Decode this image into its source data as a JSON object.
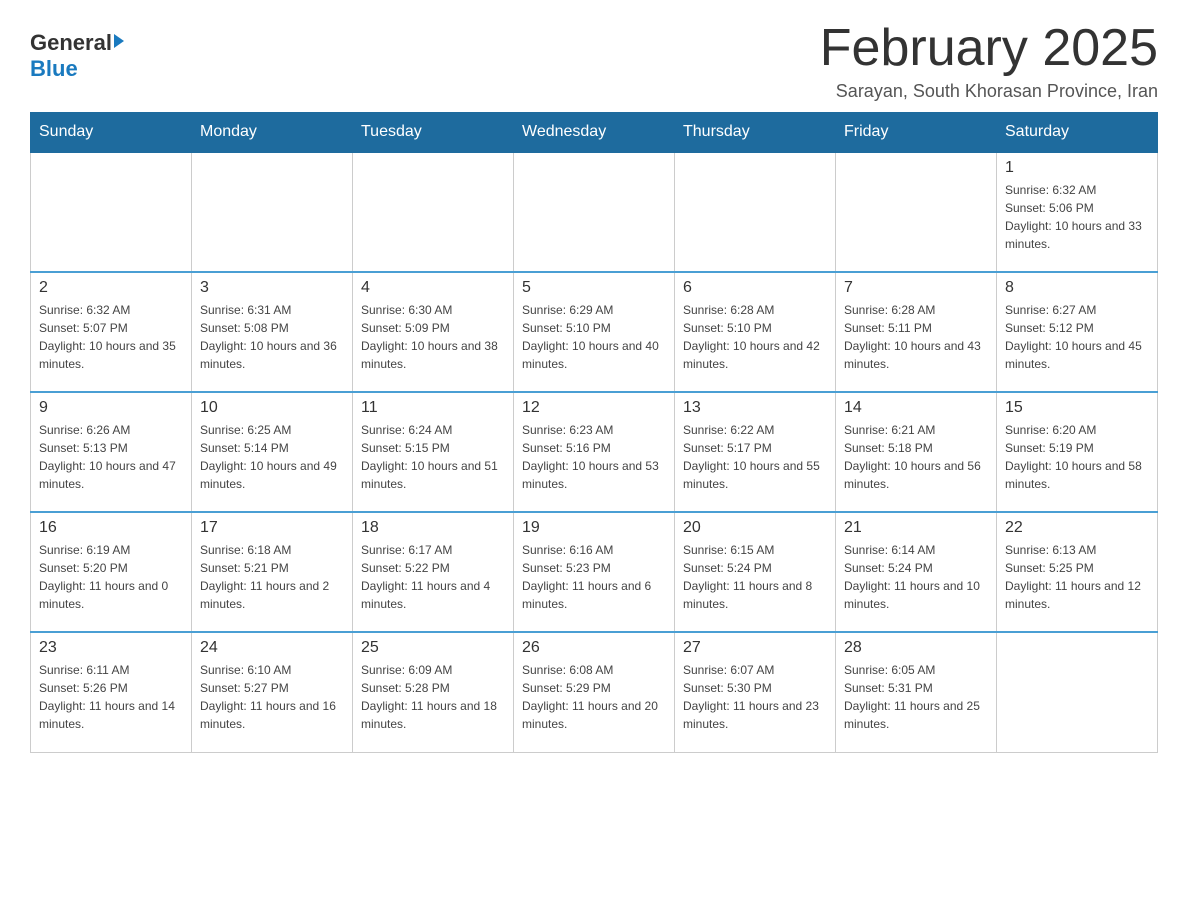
{
  "logo": {
    "general": "General",
    "blue": "Blue"
  },
  "title": {
    "month": "February 2025",
    "location": "Sarayan, South Khorasan Province, Iran"
  },
  "weekdays": [
    "Sunday",
    "Monday",
    "Tuesday",
    "Wednesday",
    "Thursday",
    "Friday",
    "Saturday"
  ],
  "weeks": [
    [
      {
        "day": null
      },
      {
        "day": null
      },
      {
        "day": null
      },
      {
        "day": null
      },
      {
        "day": null
      },
      {
        "day": null
      },
      {
        "day": "1",
        "sunrise": "6:32 AM",
        "sunset": "5:06 PM",
        "daylight": "10 hours and 33 minutes."
      }
    ],
    [
      {
        "day": "2",
        "sunrise": "6:32 AM",
        "sunset": "5:07 PM",
        "daylight": "10 hours and 35 minutes."
      },
      {
        "day": "3",
        "sunrise": "6:31 AM",
        "sunset": "5:08 PM",
        "daylight": "10 hours and 36 minutes."
      },
      {
        "day": "4",
        "sunrise": "6:30 AM",
        "sunset": "5:09 PM",
        "daylight": "10 hours and 38 minutes."
      },
      {
        "day": "5",
        "sunrise": "6:29 AM",
        "sunset": "5:10 PM",
        "daylight": "10 hours and 40 minutes."
      },
      {
        "day": "6",
        "sunrise": "6:28 AM",
        "sunset": "5:10 PM",
        "daylight": "10 hours and 42 minutes."
      },
      {
        "day": "7",
        "sunrise": "6:28 AM",
        "sunset": "5:11 PM",
        "daylight": "10 hours and 43 minutes."
      },
      {
        "day": "8",
        "sunrise": "6:27 AM",
        "sunset": "5:12 PM",
        "daylight": "10 hours and 45 minutes."
      }
    ],
    [
      {
        "day": "9",
        "sunrise": "6:26 AM",
        "sunset": "5:13 PM",
        "daylight": "10 hours and 47 minutes."
      },
      {
        "day": "10",
        "sunrise": "6:25 AM",
        "sunset": "5:14 PM",
        "daylight": "10 hours and 49 minutes."
      },
      {
        "day": "11",
        "sunrise": "6:24 AM",
        "sunset": "5:15 PM",
        "daylight": "10 hours and 51 minutes."
      },
      {
        "day": "12",
        "sunrise": "6:23 AM",
        "sunset": "5:16 PM",
        "daylight": "10 hours and 53 minutes."
      },
      {
        "day": "13",
        "sunrise": "6:22 AM",
        "sunset": "5:17 PM",
        "daylight": "10 hours and 55 minutes."
      },
      {
        "day": "14",
        "sunrise": "6:21 AM",
        "sunset": "5:18 PM",
        "daylight": "10 hours and 56 minutes."
      },
      {
        "day": "15",
        "sunrise": "6:20 AM",
        "sunset": "5:19 PM",
        "daylight": "10 hours and 58 minutes."
      }
    ],
    [
      {
        "day": "16",
        "sunrise": "6:19 AM",
        "sunset": "5:20 PM",
        "daylight": "11 hours and 0 minutes."
      },
      {
        "day": "17",
        "sunrise": "6:18 AM",
        "sunset": "5:21 PM",
        "daylight": "11 hours and 2 minutes."
      },
      {
        "day": "18",
        "sunrise": "6:17 AM",
        "sunset": "5:22 PM",
        "daylight": "11 hours and 4 minutes."
      },
      {
        "day": "19",
        "sunrise": "6:16 AM",
        "sunset": "5:23 PM",
        "daylight": "11 hours and 6 minutes."
      },
      {
        "day": "20",
        "sunrise": "6:15 AM",
        "sunset": "5:24 PM",
        "daylight": "11 hours and 8 minutes."
      },
      {
        "day": "21",
        "sunrise": "6:14 AM",
        "sunset": "5:24 PM",
        "daylight": "11 hours and 10 minutes."
      },
      {
        "day": "22",
        "sunrise": "6:13 AM",
        "sunset": "5:25 PM",
        "daylight": "11 hours and 12 minutes."
      }
    ],
    [
      {
        "day": "23",
        "sunrise": "6:11 AM",
        "sunset": "5:26 PM",
        "daylight": "11 hours and 14 minutes."
      },
      {
        "day": "24",
        "sunrise": "6:10 AM",
        "sunset": "5:27 PM",
        "daylight": "11 hours and 16 minutes."
      },
      {
        "day": "25",
        "sunrise": "6:09 AM",
        "sunset": "5:28 PM",
        "daylight": "11 hours and 18 minutes."
      },
      {
        "day": "26",
        "sunrise": "6:08 AM",
        "sunset": "5:29 PM",
        "daylight": "11 hours and 20 minutes."
      },
      {
        "day": "27",
        "sunrise": "6:07 AM",
        "sunset": "5:30 PM",
        "daylight": "11 hours and 23 minutes."
      },
      {
        "day": "28",
        "sunrise": "6:05 AM",
        "sunset": "5:31 PM",
        "daylight": "11 hours and 25 minutes."
      },
      {
        "day": null
      }
    ]
  ]
}
